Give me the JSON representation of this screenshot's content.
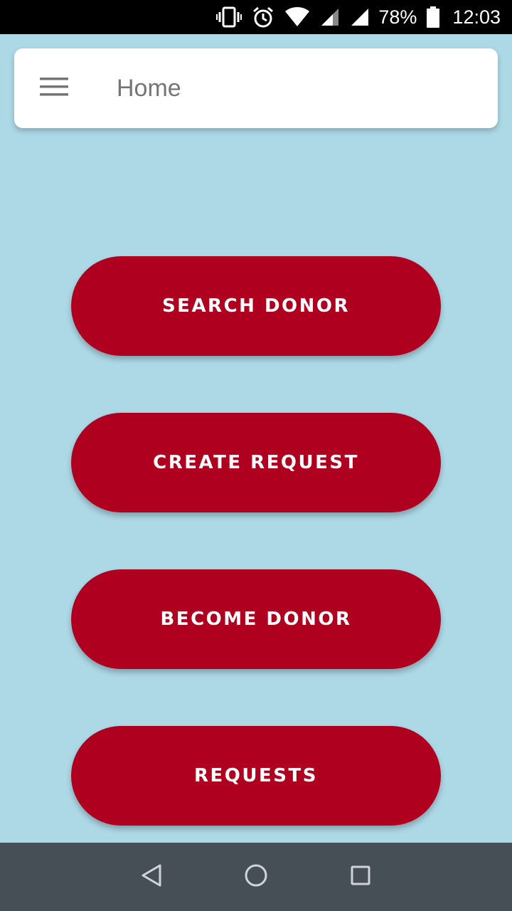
{
  "status_bar": {
    "battery": "78%",
    "time": "12:03",
    "icons": [
      "vibrate-icon",
      "alarm-icon",
      "wifi-icon",
      "signal-icon",
      "signal-icon",
      "battery-icon"
    ]
  },
  "header": {
    "menu_icon": "hamburger-menu-icon",
    "title": "Home"
  },
  "actions": [
    {
      "label": "SEARCH DONOR"
    },
    {
      "label": "CREATE REQUEST"
    },
    {
      "label": "BECOME DONOR"
    },
    {
      "label": "REQUESTS"
    }
  ],
  "navigation": {
    "icons": [
      "back-icon",
      "home-icon",
      "recents-icon"
    ]
  },
  "colors": {
    "background": "#add8e6",
    "accent": "#b00020",
    "nav_bar": "#464e56"
  }
}
